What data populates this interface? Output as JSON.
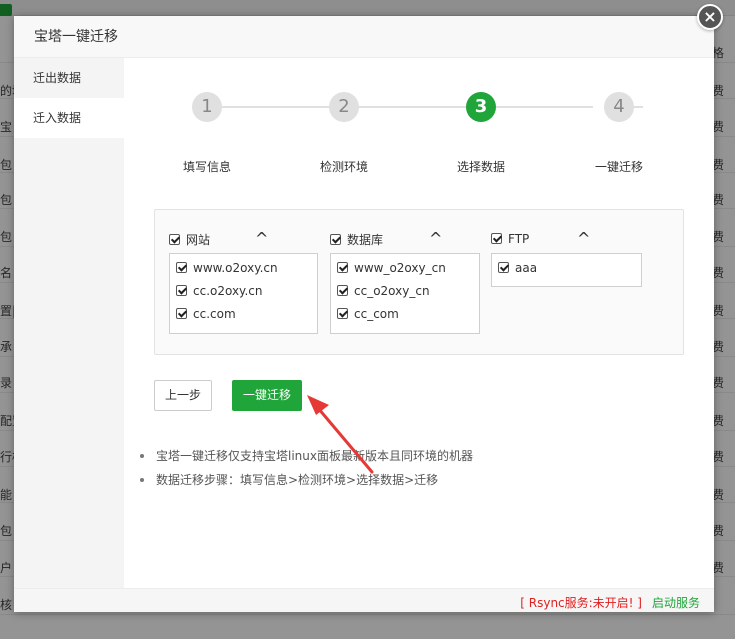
{
  "background": {
    "left_cells": [
      "的域",
      "宝",
      "包",
      "包",
      "包",
      "名",
      "置|",
      "承",
      "录",
      "配置",
      "行核",
      "能",
      "包",
      "户",
      "核"
    ],
    "right_cells": [
      "格",
      "费",
      "费",
      "费",
      "费",
      "费",
      "费",
      "费",
      "费",
      "费",
      "费",
      "费",
      "费",
      "费",
      "费"
    ]
  },
  "modal": {
    "title": "宝塔一键迁移",
    "close_glyph": "×"
  },
  "sidebar": {
    "items": [
      {
        "label": "迁出数据"
      },
      {
        "label": "迁入数据"
      }
    ]
  },
  "steps": [
    {
      "number": "1",
      "label": "填写信息"
    },
    {
      "number": "2",
      "label": "检测环境"
    },
    {
      "number": "3",
      "label": "选择数据"
    },
    {
      "number": "4",
      "label": "一键迁移"
    }
  ],
  "active_step": 3,
  "groups": [
    {
      "title": "网站",
      "caret": "^",
      "items": [
        "www.o2oxy.cn",
        "cc.o2oxy.cn",
        "cc.com"
      ]
    },
    {
      "title": "数据库",
      "caret": "^",
      "items": [
        "www_o2oxy_cn",
        "cc_o2oxy_cn",
        "cc_com"
      ]
    },
    {
      "title": "FTP",
      "caret": "^",
      "items": [
        "aaa"
      ]
    }
  ],
  "buttons": {
    "prev": "上一步",
    "go": "一键迁移"
  },
  "tips": [
    "宝塔一键迁移仅支持宝塔linux面板最新版本且同环境的机器",
    "数据迁移步骤：填写信息>检测环境>选择数据>迁移"
  ],
  "footer": {
    "rsync_status": "[ Rsync服务:未开启! ]",
    "start_service": "启动服务"
  },
  "colors": {
    "accent": "#20a53a",
    "warning": "#e02020",
    "annotation_arrow": "#e53935"
  }
}
